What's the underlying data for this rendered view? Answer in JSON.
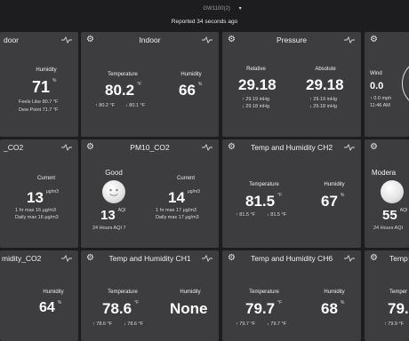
{
  "header": {
    "device": "GW1100(2)",
    "caret": "▾",
    "reported": "Reported 34 seconds ago"
  },
  "icons": {
    "settings": "gear-icon",
    "chart": "pulse-icon"
  },
  "row1": {
    "c1": {
      "title": "door",
      "humidity_label": "Humidity",
      "humidity": "71",
      "humidity_unit": "%",
      "feels_like": "Feels Like  80.7 °F",
      "dew_point": "Dew Point  71.7 °F"
    },
    "c2": {
      "title": "Indoor",
      "temp_label": "Temperature",
      "temp": "80.2",
      "temp_unit": "°F",
      "hum_label": "Humidity",
      "hum": "66",
      "hum_unit": "%",
      "temp_hi": "↑ 80.2 °F",
      "temp_lo": "↓ 80.1 °F"
    },
    "c3": {
      "title": "Pressure",
      "rel_label": "Relative",
      "rel": "29.18",
      "abs_label": "Absolute",
      "abs": "29.18",
      "rel_hi": "↑ 29.19 inHg",
      "rel_lo": "↓ 29.18 inHg",
      "abs_hi": "↑ 29.19 inHg",
      "abs_lo": "↓ 29.18 inHg"
    },
    "c4": {
      "wind_label": "Wind",
      "wind": "0.0",
      "wind_hi": "↑ 0.0 mph",
      "wind_time": "11:46 AM"
    }
  },
  "row2": {
    "c1": {
      "title": "_CO2",
      "current_label": "Current",
      "current": "13",
      "current_unit": "μg/m3",
      "hr_max": "1 hr max   16 μg/m3",
      "daily_max": "Daily max  16 μg/m3"
    },
    "c2": {
      "title": "PM10_CO2",
      "good_label": "Good",
      "current_label": "Current",
      "current": "14",
      "current_unit": "μg/m3",
      "aqi": "13",
      "aqi_unit": "AQI",
      "aqi_24": "24 Hours AQI    7",
      "hr_max": "1 hr max   17 μg/m3",
      "daily_max": "Daily max  17 μg/m3"
    },
    "c3": {
      "title": "Temp and Humidity CH2",
      "temp_label": "Temperature",
      "temp": "81.5",
      "temp_unit": "°F",
      "hum_label": "Humidity",
      "hum": "67",
      "hum_unit": "%",
      "temp_hi": "↑ 81.5 °F",
      "temp_lo": "↓ 81.5 °F"
    },
    "c4": {
      "level_label": "Modera",
      "aqi": "55",
      "aqi_unit": "AQI",
      "aqi_24": "24 Hours AQI"
    }
  },
  "row3": {
    "c1": {
      "title": "midity_CO2",
      "hum_label": "Humidity",
      "hum": "64",
      "hum_unit": "%"
    },
    "c2": {
      "title": "Temp and Humidity CH1",
      "temp_label": "Temperature",
      "temp": "78.6",
      "temp_unit": "°F",
      "hum_label": "Humidity",
      "hum": "None",
      "temp_hi": "↑ 78.6 °F",
      "temp_lo": "↓ 78.6 °F"
    },
    "c3": {
      "title": "Temp and Humidity CH6",
      "temp_label": "Temperature",
      "temp": "79.7",
      "temp_unit": "°F",
      "hum_label": "Humidity",
      "hum": "68",
      "hum_unit": "%",
      "temp_hi": "↑ 79.7 °F",
      "temp_lo": "↓ 79.7 °F"
    },
    "c4": {
      "title": "Temp",
      "temp_label": "Temper",
      "temp": "79.",
      "temp_hi": "↑ 79.9 °F"
    }
  }
}
